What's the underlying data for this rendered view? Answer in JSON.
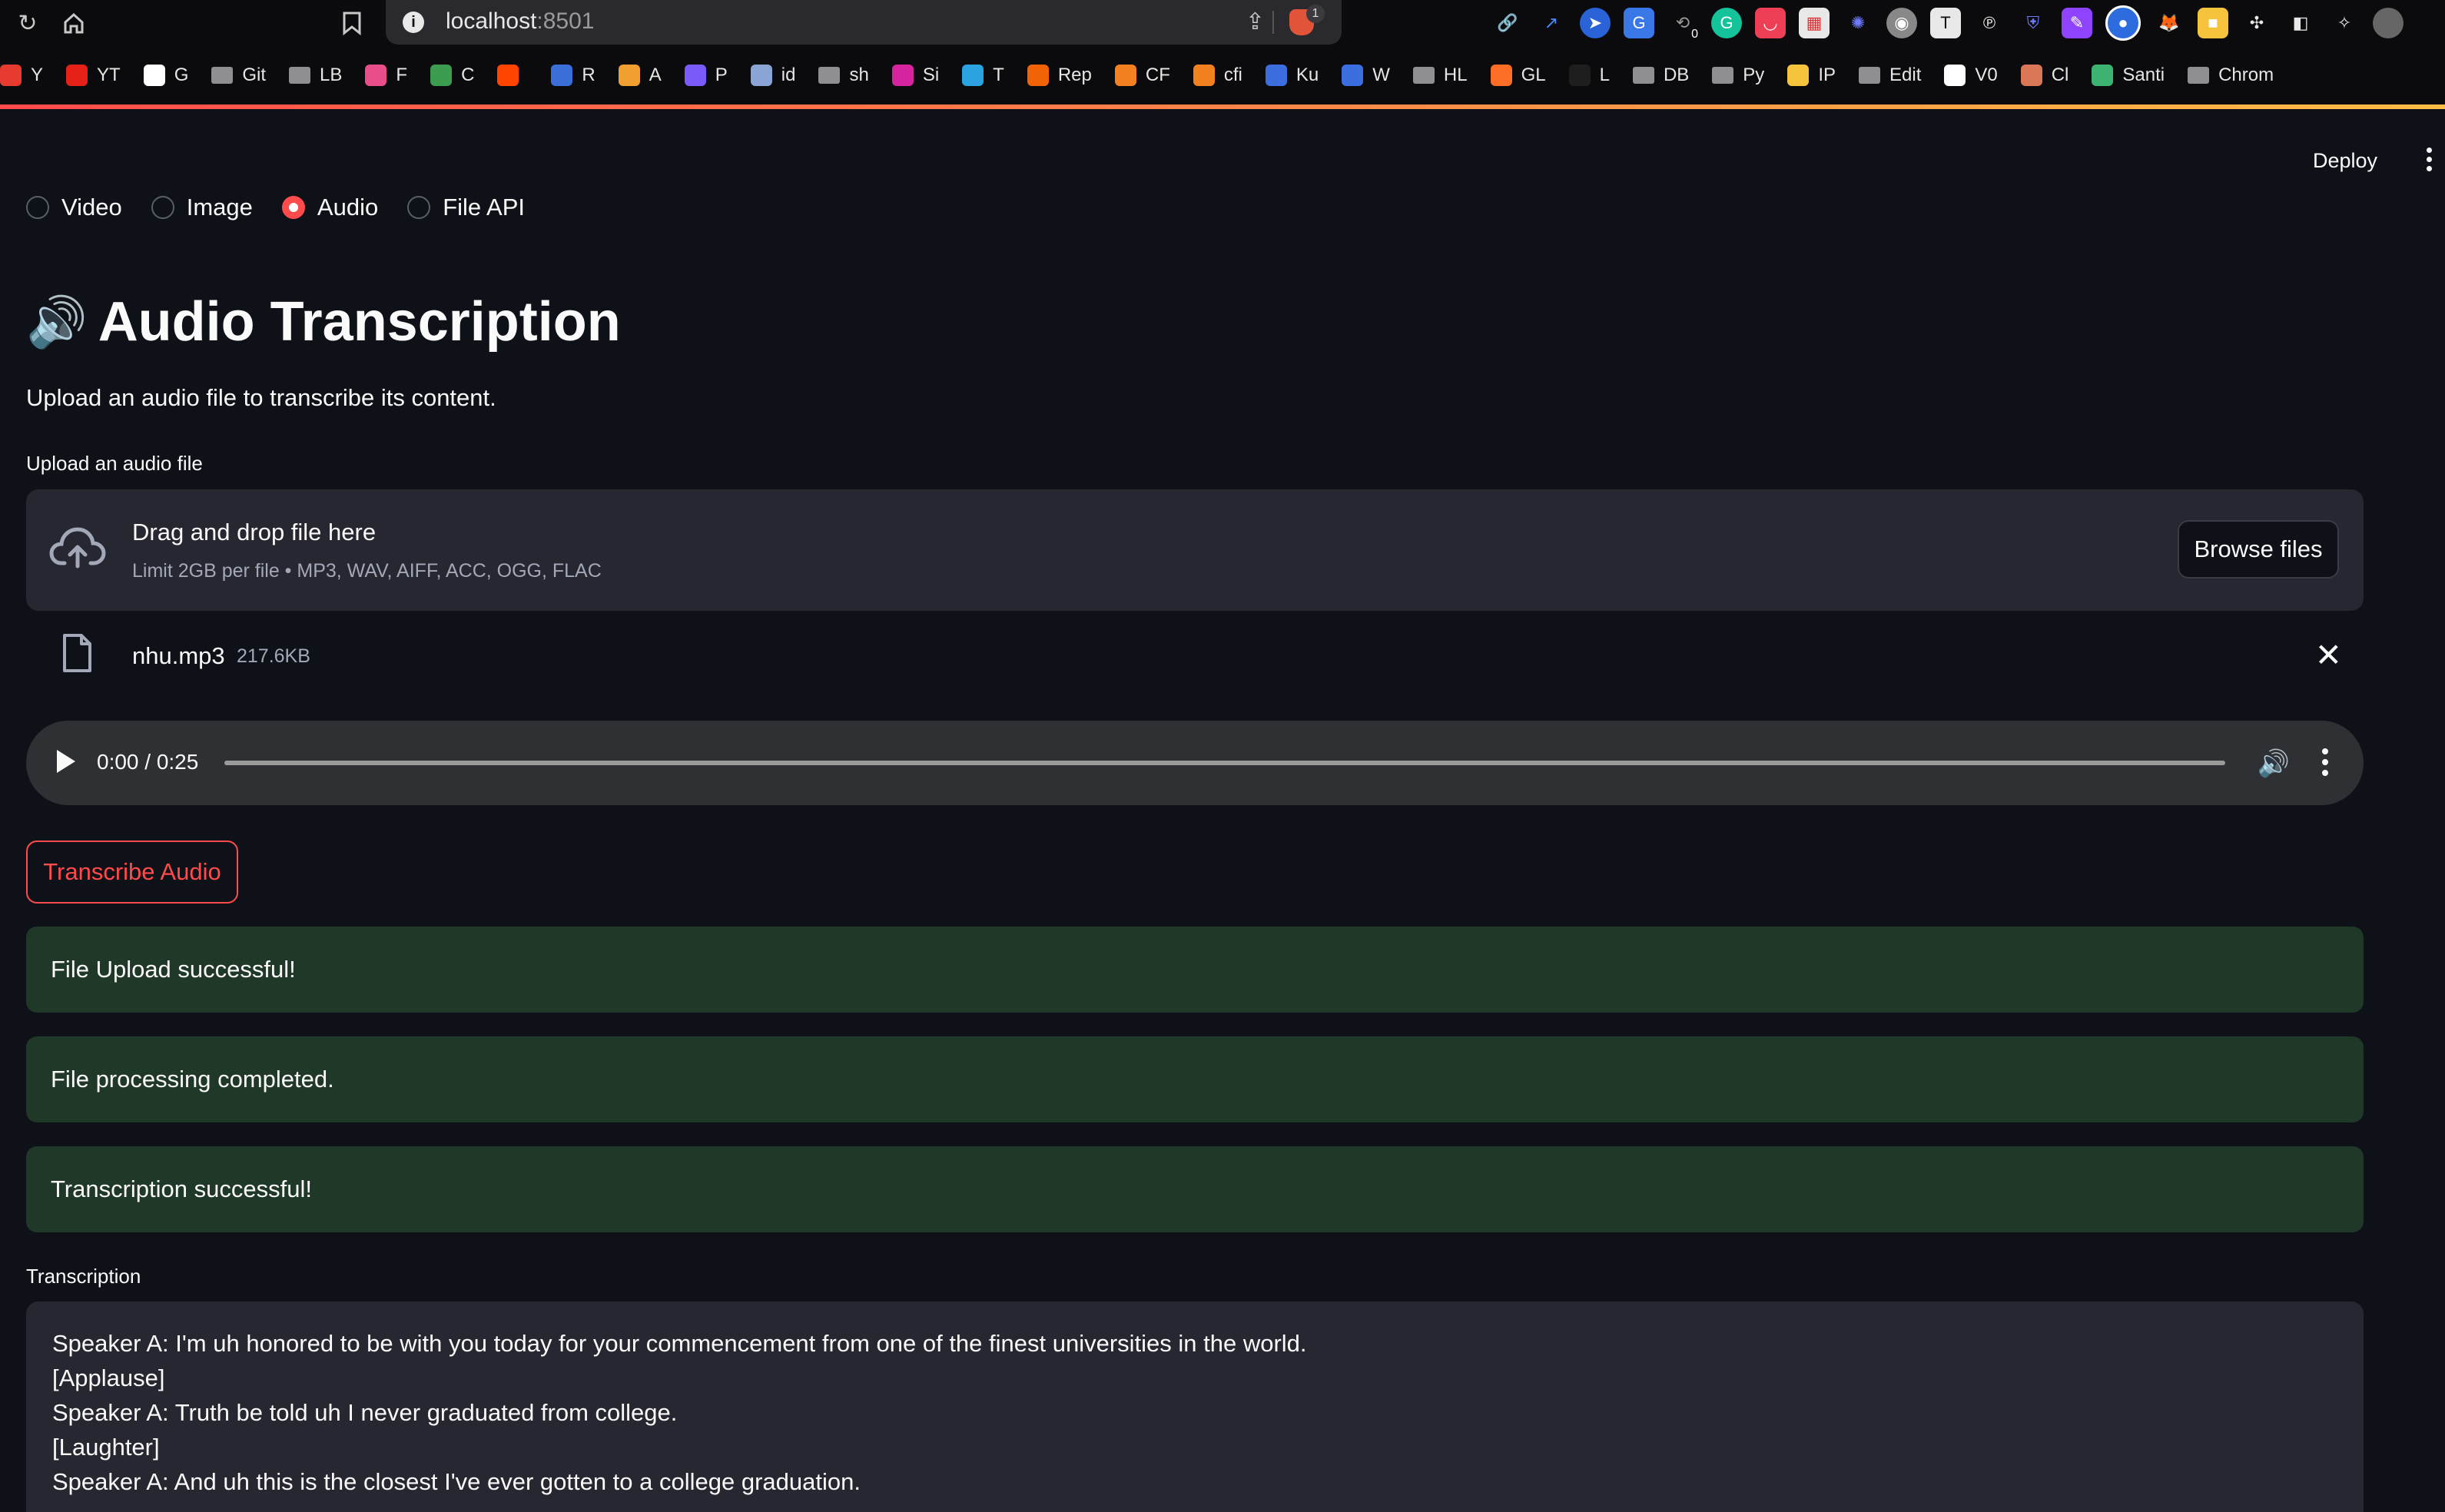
{
  "browser": {
    "url_host": "localhost",
    "url_port": ":8501",
    "shield_count": "1",
    "bookmarks": [
      {
        "label": "Y",
        "color": "#e63b2e"
      },
      {
        "label": "YT",
        "color": "#e62117"
      },
      {
        "label": "G",
        "color": "#ffffff"
      },
      {
        "label": "Git",
        "color": "folder"
      },
      {
        "label": "LB",
        "color": "folder"
      },
      {
        "label": "F",
        "color": "#e94e8a"
      },
      {
        "label": "C",
        "color": "#3c9c4f"
      },
      {
        "label": "",
        "color": "#ff4500"
      },
      {
        "label": "R",
        "color": "#3b6fd8"
      },
      {
        "label": "A",
        "color": "#f0a030"
      },
      {
        "label": "P",
        "color": "#7a5af8"
      },
      {
        "label": "id",
        "color": "#8aa4d6"
      },
      {
        "label": "sh",
        "color": "folder"
      },
      {
        "label": "Si",
        "color": "#d6249f"
      },
      {
        "label": "T",
        "color": "#2aa3e0"
      },
      {
        "label": "Rep",
        "color": "#f26207"
      },
      {
        "label": "CF",
        "color": "#f48120"
      },
      {
        "label": "cfi",
        "color": "#f48120"
      },
      {
        "label": "Ku",
        "color": "#3d6ee0"
      },
      {
        "label": "W",
        "color": "#3d6ee0"
      },
      {
        "label": "HL",
        "color": "folder"
      },
      {
        "label": "GL",
        "color": "#fc6d26"
      },
      {
        "label": "L",
        "color": "#1e1e1e"
      },
      {
        "label": "DB",
        "color": "folder"
      },
      {
        "label": "Py",
        "color": "folder"
      },
      {
        "label": "IP",
        "color": "#f6c33c"
      },
      {
        "label": "Edit",
        "color": "folder"
      },
      {
        "label": "V0",
        "color": "#ffffff"
      },
      {
        "label": "Cl",
        "color": "#d97757"
      },
      {
        "label": "Santi",
        "color": "#3cb371"
      },
      {
        "label": "Chrom",
        "color": "folder"
      }
    ],
    "extensions_badge": "0"
  },
  "app": {
    "deploy_label": "Deploy",
    "modes": [
      {
        "label": "Video",
        "selected": false
      },
      {
        "label": "Image",
        "selected": false
      },
      {
        "label": "Audio",
        "selected": true
      },
      {
        "label": "File API",
        "selected": false
      }
    ],
    "title_icon": "🔊",
    "title": "Audio Transcription",
    "subtitle": "Upload an audio file to transcribe its content.",
    "uploader": {
      "label": "Upload an audio file",
      "drop_text": "Drag and drop file here",
      "limit_text": "Limit 2GB per file • MP3, WAV, AIFF, ACC, OGG, FLAC",
      "browse_label": "Browse files"
    },
    "file": {
      "name": "nhu.mp3",
      "size": "217.6KB"
    },
    "player": {
      "time": "0:00 / 0:25",
      "progress": 0
    },
    "transcribe_label": "Transcribe Audio",
    "alerts": [
      "File Upload successful!",
      "File processing completed.",
      "Transcription successful!"
    ],
    "transcription": {
      "label": "Transcription",
      "lines": [
        "Speaker A: I'm uh honored to be with you today for your commencement from one of the finest universities in the world.",
        "[Applause]",
        "Speaker A: Truth be told uh I never graduated from college.",
        "[Laughter]",
        "Speaker A: And uh this is the closest I've ever gotten to a college graduation."
      ]
    }
  },
  "colors": {
    "background": "#0e1117",
    "accent": "#ff4b4b",
    "success_bg": "#203828",
    "panel": "#262730"
  }
}
